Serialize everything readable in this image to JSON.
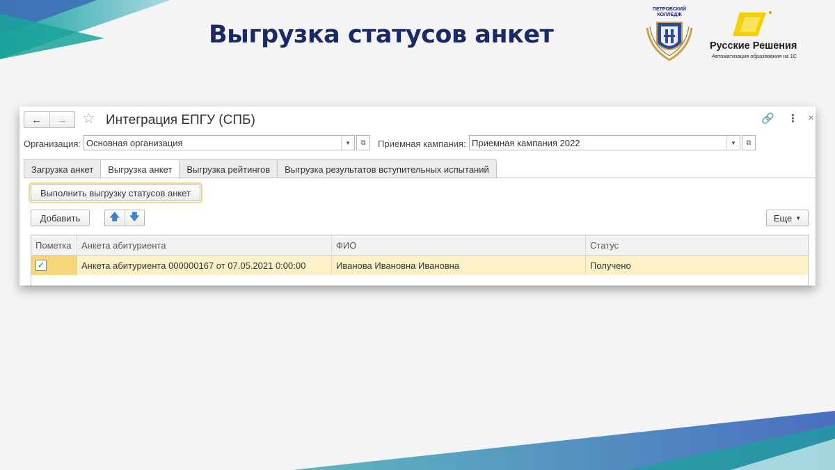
{
  "slide": {
    "title": "Выгрузка статусов анкет",
    "logos": {
      "college": {
        "caption_line1": "ПЕТРОВСКИЙ",
        "caption_line2": "КОЛЛЕДЖ",
        "icon": "college-crest"
      },
      "brand": {
        "name": "Русские Решения",
        "tagline": "Автоматизация образования на 1С",
        "icon": "brand-shape"
      }
    },
    "colors": {
      "title": "#1a2a66",
      "accent_teal": "#1aa39b",
      "accent_blue": "#4a6fc0",
      "row_highlight": "#fbf0c8"
    }
  },
  "window": {
    "title": "Интеграция ЕПГУ (СПБ)",
    "nav": {
      "back_icon": "arrow-left-icon",
      "forward_icon": "arrow-right-icon"
    },
    "toolbar_icons": [
      "link-icon",
      "more-icon",
      "close-icon"
    ],
    "organization": {
      "label": "Организация:",
      "value": "Основная организация"
    },
    "campaign": {
      "label": "Приемная кампания:",
      "value": "Приемная кампания 2022"
    },
    "tabs": [
      {
        "label": "Загрузка анкет",
        "active": false
      },
      {
        "label": "Выгрузка анкет",
        "active": true
      },
      {
        "label": "Выгрузка рейтингов",
        "active": false
      },
      {
        "label": "Выгрузка результатов вступительных испытаний",
        "active": false
      }
    ],
    "buttons": {
      "execute": "Выполнить выгрузку статусов анкет",
      "add": "Добавить",
      "more": "Еще"
    },
    "table": {
      "columns": [
        "Пометка",
        "Анкета абитуриента",
        "ФИО",
        "Статус"
      ],
      "rows": [
        {
          "checked": true,
          "form": "Анкета абитуриента 000000167 от 07.05.2021 0:00:00",
          "name": "Иванова Ивановна Ивановна",
          "status": "Получено"
        }
      ]
    }
  }
}
